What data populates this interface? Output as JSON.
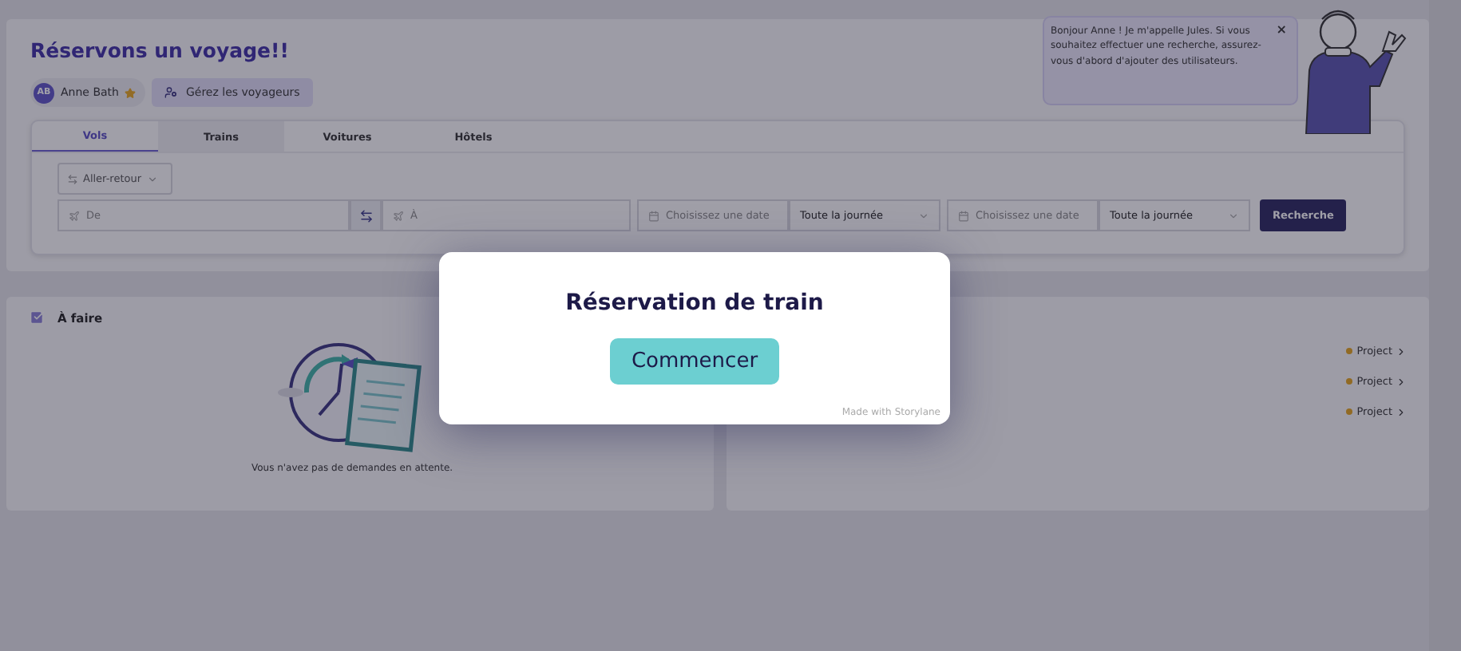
{
  "page": {
    "title": "Réservons un voyage!!"
  },
  "traveler": {
    "initials": "AB",
    "name": "Anne Bath",
    "starred": true
  },
  "manage_button": "Gérez les voyageurs",
  "assistant": {
    "message": "Bonjour Anne ! Je m'appelle Jules. Si vous souhaitez effectuer une recherche, assurez-vous d'abord d'ajouter des utilisateurs.",
    "close": "×"
  },
  "tabs": [
    {
      "label": "Vols",
      "selected": true
    },
    {
      "label": "Trains",
      "selected": false
    },
    {
      "label": "Voitures",
      "selected": false
    },
    {
      "label": "Hôtels",
      "selected": false
    }
  ],
  "trip_type": "Aller-retour",
  "search": {
    "from": {
      "placeholder": "De"
    },
    "to": {
      "placeholder": "À"
    },
    "depart_date": {
      "placeholder": "Choisissez une date"
    },
    "depart_time": "Toute la journée",
    "return_date": {
      "placeholder": "Choisissez une date"
    },
    "return_time": "Toute la journée",
    "button": "Recherche"
  },
  "todo": {
    "title": "À faire",
    "empty_text": "Vous n'avez pas de demandes en attente."
  },
  "trips": [
    {
      "label": "Project"
    },
    {
      "label": "Project"
    },
    {
      "label": "Project"
    }
  ],
  "modal": {
    "title": "Réservation de train",
    "button": "Commencer",
    "footer": "Made with",
    "brand": "Storylane"
  }
}
